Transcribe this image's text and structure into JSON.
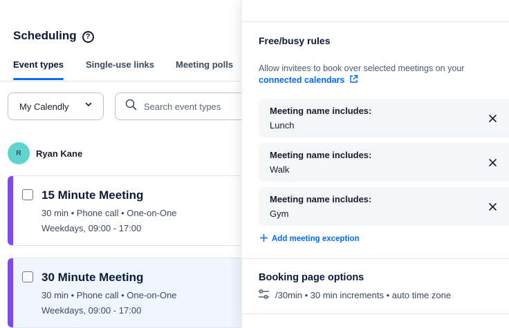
{
  "header": {
    "title": "Scheduling",
    "help_icon": "question-circle-icon"
  },
  "tabs": [
    {
      "label": "Event types",
      "active": true
    },
    {
      "label": "Single-use links",
      "active": false
    },
    {
      "label": "Meeting polls",
      "active": false
    }
  ],
  "filters": {
    "calendar_select": "My Calendly",
    "search_placeholder": "Search event types",
    "search_value": ""
  },
  "user": {
    "initial": "R",
    "name": "Ryan Kane",
    "avatar_color": "#5fd4cf"
  },
  "event_types": [
    {
      "title": "15 Minute Meeting",
      "meta": "30 min • Phone call • One-on-One",
      "schedule": "Weekdays, 09:00 - 17:00",
      "color": "#8247f5",
      "selected": false
    },
    {
      "title": "30 Minute Meeting",
      "meta": "30 min • Phone call • One-on-One",
      "schedule": "Weekdays, 09:00 - 17:00",
      "color": "#8247f5",
      "selected": true
    }
  ],
  "panel": {
    "free_busy": {
      "title": "Free/busy rules",
      "description": "Allow invitees to book over selected meetings on your",
      "link": "connected calendars",
      "link_icon": "external-link-icon",
      "rules": [
        {
          "label": "Meeting name includes:",
          "value": "Lunch"
        },
        {
          "label": "Meeting name includes:",
          "value": "Walk"
        },
        {
          "label": "Meeting name includes:",
          "value": "Gym"
        }
      ],
      "add_exception": "Add meeting exception"
    },
    "booking_page": {
      "title": "Booking page options",
      "summary": "/30min • 30 min increments • auto time zone",
      "icon": "sliders-icon"
    }
  },
  "colors": {
    "accent": "#006bff",
    "event_stripe": "#8247f5",
    "selected_card_bg": "#f0f6ff"
  }
}
